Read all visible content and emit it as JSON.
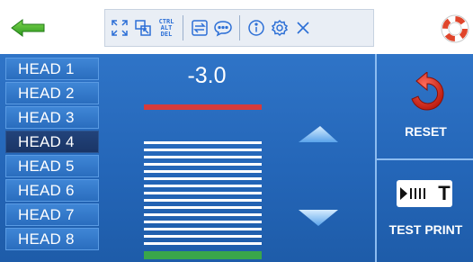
{
  "toolbar": {
    "icons": [
      "expand-icon",
      "fit-screen-icon",
      "ctrl-alt-del-icon",
      "switch-icon",
      "chat-icon",
      "info-icon",
      "settings-icon",
      "close-icon"
    ],
    "cad_line1": "CTRL",
    "cad_line2": "ALT",
    "cad_line3": "DEL"
  },
  "heads": [
    "HEAD 1",
    "HEAD 2",
    "HEAD 3",
    "HEAD 4",
    "HEAD 5",
    "HEAD 6",
    "HEAD 7",
    "HEAD 8"
  ],
  "selected_head": "HEAD 4",
  "adjust": {
    "value": "-3.0"
  },
  "actions": {
    "reset_label": "RESET",
    "test_print_label": "TEST PRINT",
    "test_print_glyph": "T"
  },
  "colors": {
    "accent": "#2466b8",
    "red_line": "#d63b3b",
    "green_line": "#39a64a",
    "back_arrow": "#3aa629"
  }
}
